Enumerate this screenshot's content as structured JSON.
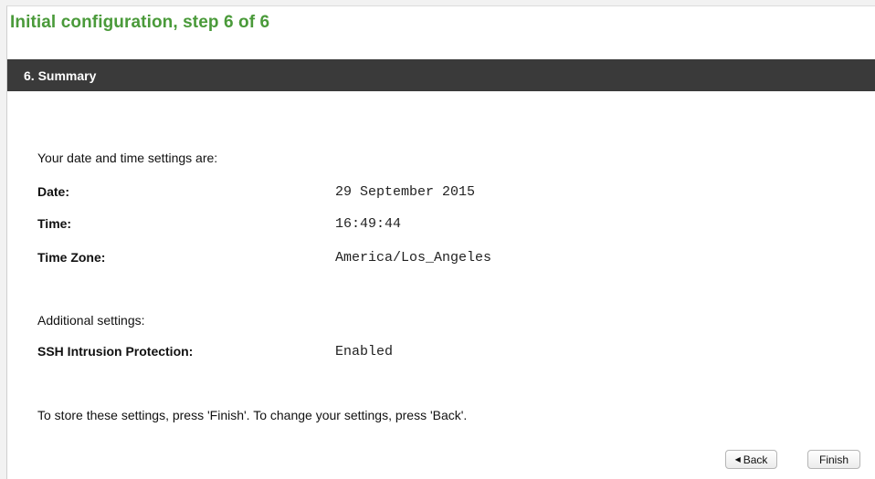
{
  "page_title": "Initial configuration, step 6 of 6",
  "section": {
    "title": "6. Summary"
  },
  "datetime": {
    "intro": "Your date and time settings are:",
    "rows": [
      {
        "label": "Date:",
        "value": "29 September 2015"
      },
      {
        "label": "Time:",
        "value": "16:49:44"
      },
      {
        "label": "Time Zone:",
        "value": "America/Los_Angeles"
      }
    ]
  },
  "additional": {
    "intro": "Additional settings:",
    "rows": [
      {
        "label": "SSH Intrusion Protection:",
        "value": "Enabled"
      }
    ]
  },
  "instruction": "To store these settings, press 'Finish'. To change your settings, press 'Back'.",
  "buttons": {
    "back_label": "Back",
    "back_icon": "triangle-left-icon",
    "finish_label": "Finish"
  },
  "colors": {
    "title_green": "#4a9a3a",
    "section_bar": "#3a3a3a"
  }
}
